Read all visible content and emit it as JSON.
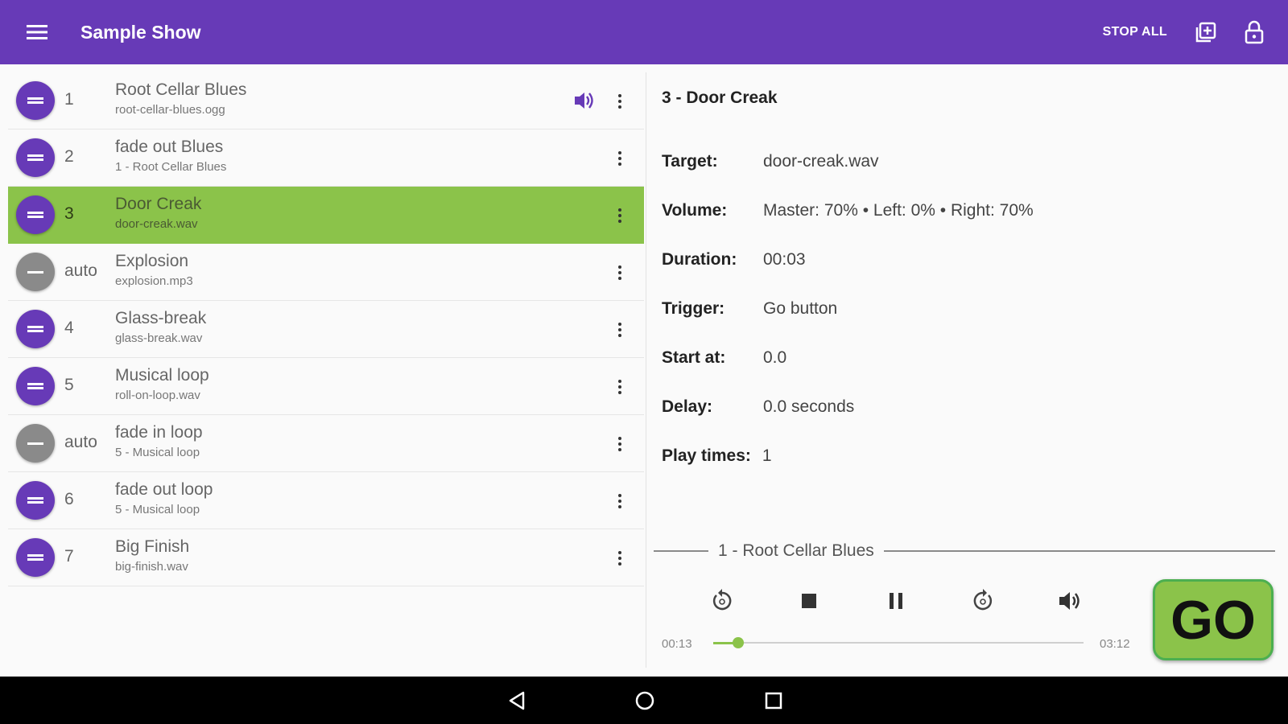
{
  "appbar": {
    "title": "Sample Show",
    "stop_all": "STOP ALL",
    "menu_icon": "hamburger-menu-icon",
    "add_icon": "add-to-library-icon",
    "lock_icon": "lock-icon"
  },
  "cues": [
    {
      "number": "1",
      "title": "Root Cellar Blues",
      "subtitle": "root-cellar-blues.ogg",
      "auto": false,
      "selected": false,
      "playing": true
    },
    {
      "number": "2",
      "title": "fade out Blues",
      "subtitle": "1 - Root Cellar Blues",
      "auto": false,
      "selected": false,
      "playing": false
    },
    {
      "number": "3",
      "title": "Door Creak",
      "subtitle": "door-creak.wav",
      "auto": false,
      "selected": true,
      "playing": false
    },
    {
      "number": "auto",
      "title": "Explosion",
      "subtitle": "explosion.mp3",
      "auto": true,
      "selected": false,
      "playing": false
    },
    {
      "number": "4",
      "title": "Glass-break",
      "subtitle": "glass-break.wav",
      "auto": false,
      "selected": false,
      "playing": false
    },
    {
      "number": "5",
      "title": "Musical loop",
      "subtitle": "roll-on-loop.wav",
      "auto": false,
      "selected": false,
      "playing": false
    },
    {
      "number": "auto",
      "title": "fade in loop",
      "subtitle": "5 - Musical loop",
      "auto": true,
      "selected": false,
      "playing": false
    },
    {
      "number": "6",
      "title": "fade out loop",
      "subtitle": "5 - Musical loop",
      "auto": false,
      "selected": false,
      "playing": false
    },
    {
      "number": "7",
      "title": "Big Finish",
      "subtitle": "big-finish.wav",
      "auto": false,
      "selected": false,
      "playing": false
    }
  ],
  "details": {
    "title": "3 - Door Creak",
    "rows": [
      {
        "label": "Target:",
        "value": "door-creak.wav"
      },
      {
        "label": "Volume:",
        "value": "Master: 70% • Left: 0% • Right: 70%"
      },
      {
        "label": "Duration:",
        "value": "00:03"
      },
      {
        "label": "Trigger:",
        "value": "Go button"
      },
      {
        "label": "Start at:",
        "value": "0.0"
      },
      {
        "label": "Delay:",
        "value": "0.0 seconds"
      },
      {
        "label": "Play times:",
        "value": "1"
      }
    ]
  },
  "player": {
    "now_playing": "1 - Root Cellar Blues",
    "elapsed": "00:13",
    "total": "03:12",
    "progress_fraction": 0.068,
    "buttons": [
      "rewind-10-icon",
      "stop-icon",
      "pause-icon",
      "forward-10-icon",
      "volume-icon"
    ]
  },
  "go_label": "GO",
  "colors": {
    "primary": "#673ab7",
    "accent_green": "#8bc34a",
    "auto_gray": "#8a8a8a"
  }
}
